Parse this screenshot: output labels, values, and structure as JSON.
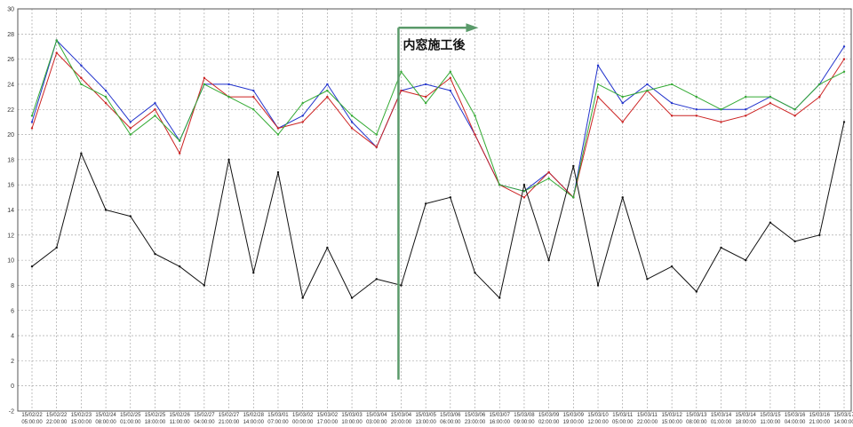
{
  "chart_data": {
    "type": "line",
    "title": "",
    "xlabel": "",
    "ylabel": "",
    "ylim": [
      -2,
      30
    ],
    "yticks": [
      -2,
      0,
      2,
      4,
      6,
      8,
      10,
      12,
      14,
      16,
      18,
      20,
      22,
      24,
      26,
      28,
      30
    ],
    "grid": true,
    "legend": "none",
    "annotation": {
      "text": "内窓施工後",
      "at_category_index": 15,
      "arrow_color": "#5a9a6a"
    },
    "categories": [
      "15/02/22 05:00:00",
      "15/02/22 22:00:00",
      "15/02/23 15:00:00",
      "15/02/24 08:00:00",
      "15/02/25 01:00:00",
      "15/02/25 18:00:00",
      "15/02/26 11:00:00",
      "15/02/27 04:00:00",
      "15/02/27 21:00:00",
      "15/02/28 14:00:00",
      "15/03/01 07:00:00",
      "15/03/02 00:00:00",
      "15/03/02 17:00:00",
      "15/03/03 10:00:00",
      "15/03/04 03:00:00",
      "15/03/04 20:00:00",
      "15/03/05 13:00:00",
      "15/03/06 06:00:00",
      "15/03/06 23:00:00",
      "15/03/07 16:00:00",
      "15/03/08 09:00:00",
      "15/03/09 02:00:00",
      "15/03/09 19:00:00",
      "15/03/10 12:00:00",
      "15/03/11 05:00:00",
      "15/03/11 22:00:00",
      "15/03/12 15:00:00",
      "15/03/13 08:00:00",
      "15/03/14 01:00:00",
      "15/03/14 18:00:00",
      "15/03/15 11:00:00",
      "15/03/16 04:00:00",
      "15/03/16 21:00:00",
      "15/03/17 14:00:00"
    ],
    "series": [
      {
        "color": "#2233cc",
        "values": [
          21,
          27.5,
          25.5,
          23.5,
          21,
          22.5,
          19.5,
          24,
          24,
          23.5,
          20.5,
          21.5,
          24,
          21,
          19,
          23.5,
          24,
          23.5,
          20,
          16,
          15.5,
          17,
          15,
          25.5,
          22.5,
          24,
          22.5,
          22,
          22,
          22,
          23,
          22,
          24,
          27
        ]
      },
      {
        "color": "#cc2222",
        "values": [
          20.5,
          26.5,
          24.5,
          22.5,
          20.5,
          22,
          18.5,
          24.5,
          23,
          23,
          20.5,
          21,
          23,
          20.5,
          19,
          23.5,
          23,
          24.5,
          20,
          16,
          15,
          17,
          15,
          23,
          21,
          23.5,
          21.5,
          21.5,
          21,
          21.5,
          22.5,
          21.5,
          23,
          26
        ]
      },
      {
        "color": "#33aa33",
        "values": [
          21.5,
          27.5,
          24,
          23,
          20,
          21.5,
          19.5,
          24,
          23,
          22,
          20,
          22.5,
          23.5,
          21.5,
          20,
          25,
          22.5,
          25,
          21.5,
          16,
          15.5,
          16.5,
          15,
          24,
          23,
          23.5,
          24,
          23,
          22,
          23,
          23,
          22,
          24,
          25
        ]
      },
      {
        "color": "#111111",
        "values": [
          9.5,
          11,
          18.5,
          14,
          13.5,
          10.5,
          9.5,
          8,
          18,
          9,
          17,
          7,
          11,
          7,
          8.5,
          8,
          14.5,
          15,
          9,
          7,
          16,
          10,
          17.5,
          8,
          15,
          8.5,
          9.5,
          7.5,
          11,
          10,
          13,
          11.5,
          12,
          21
        ]
      }
    ]
  }
}
